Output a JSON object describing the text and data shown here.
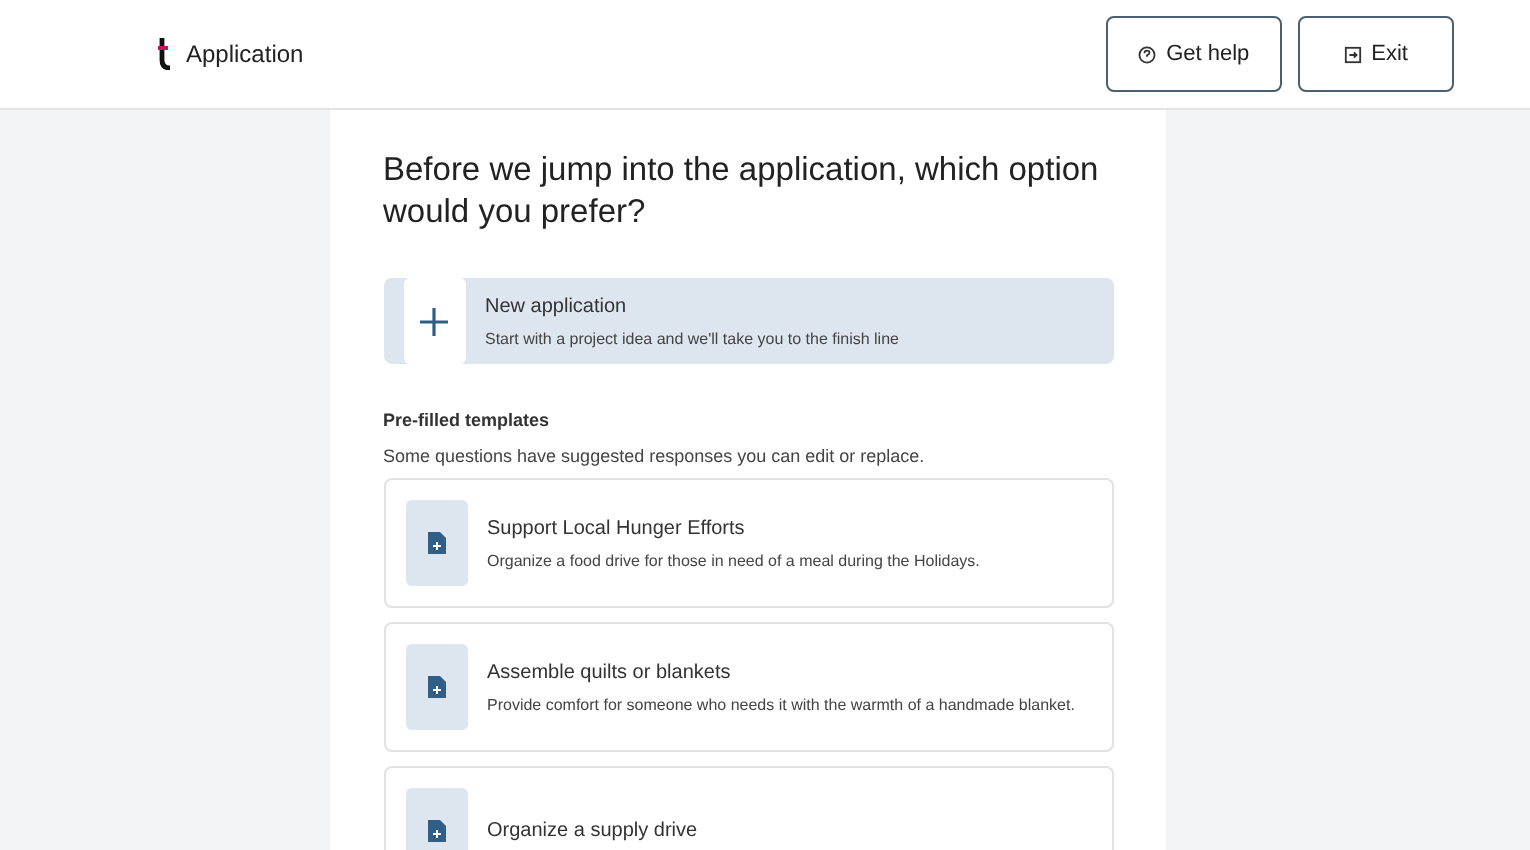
{
  "header": {
    "title": "Application",
    "buttons": [
      {
        "kind": "help",
        "label": "Get help"
      },
      {
        "kind": "exit",
        "label": "Exit"
      }
    ]
  },
  "heading": "Before we jump into the application, which option would you prefer?",
  "new_application": {
    "title": "New application",
    "description": "Start with a project idea and we'll take you to the finish line"
  },
  "templates": {
    "title": "Pre-filled templates",
    "subtitle": "Some questions have suggested responses you can edit or replace.",
    "items": [
      {
        "title": "Support Local Hunger Efforts",
        "description": "Organize a food drive for those in need of a meal during the Holidays."
      },
      {
        "title": "Assemble quilts or blankets",
        "description": "Provide comfort for someone who needs it with the warmth of a handmade blanket."
      },
      {
        "title": "Organize a supply drive"
      }
    ]
  }
}
